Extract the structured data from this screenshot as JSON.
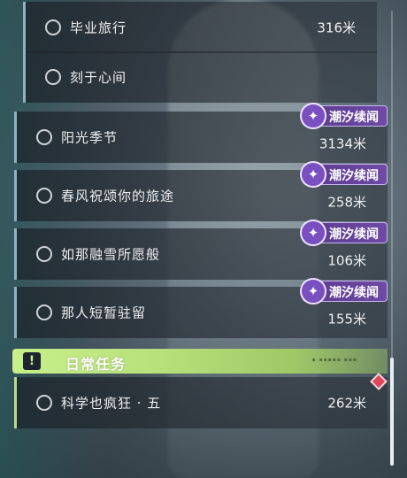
{
  "quests": [
    {
      "name": "毕业旅行",
      "distance": "316米",
      "tag": null
    },
    {
      "name": "刻于心间",
      "distance": "",
      "tag": null
    },
    {
      "name": "阳光季节",
      "distance": "3134米",
      "tag": "潮汐续闻"
    },
    {
      "name": "春风祝颂你的旅途",
      "distance": "258米",
      "tag": "潮汐续闻"
    },
    {
      "name": "如那融雪所愿般",
      "distance": "106米",
      "tag": "潮汐续闻"
    },
    {
      "name": "那人短暂驻留",
      "distance": "155米",
      "tag": "潮汐续闻"
    }
  ],
  "daily_section": {
    "title": "日常任务",
    "icon": "exclamation-icon"
  },
  "daily_quests": [
    {
      "name": "科学也疯狂 · 五",
      "distance": "262米"
    }
  ],
  "colors": {
    "tag_purple": "#6e4aa6",
    "daily_green": "#c7ef8a",
    "marker_red": "#e0455a"
  }
}
